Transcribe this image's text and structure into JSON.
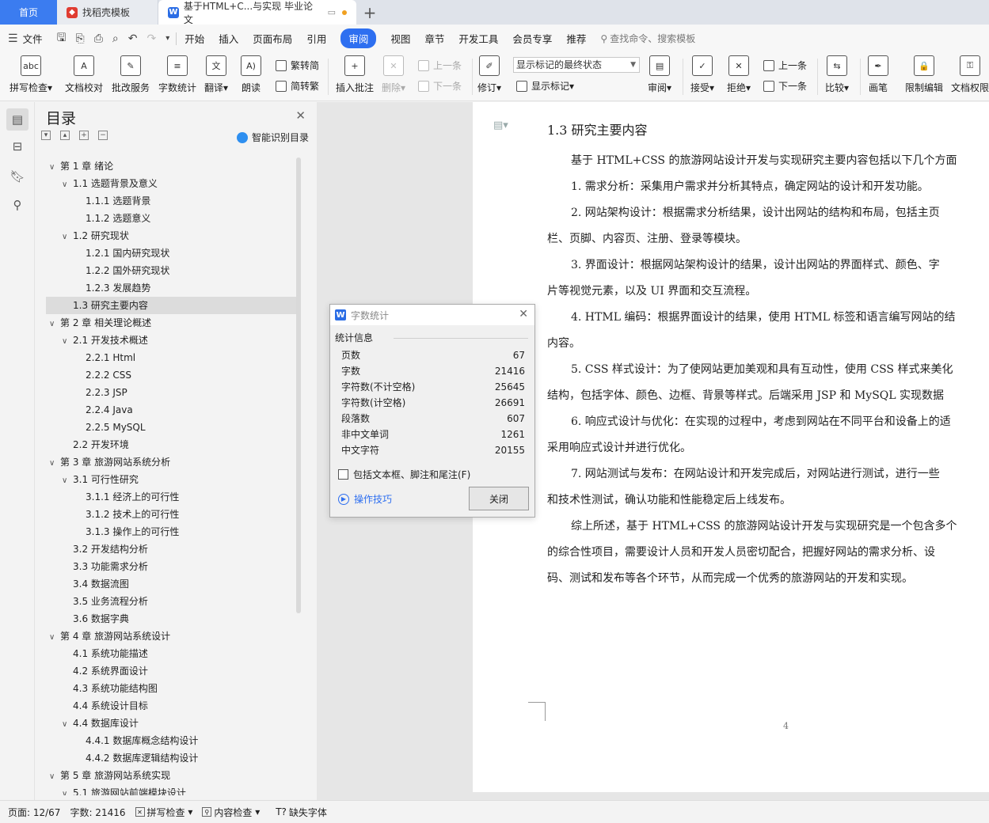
{
  "tabs": {
    "home": "首页",
    "template": "找稻壳模板",
    "document": "基于HTML+C...与实现 毕业论文",
    "new_tab": "+"
  },
  "menu": {
    "file": "文件",
    "items": [
      "开始",
      "插入",
      "页面布局",
      "引用",
      "审阅",
      "视图",
      "章节",
      "开发工具",
      "会员专享",
      "推荐"
    ],
    "active": "审阅",
    "search": "查找命令、搜索模板"
  },
  "ribbon": {
    "spell_check": "拼写检查",
    "doc_proof": "文档校对",
    "batch_service": "批改服务",
    "word_count": "字数统计",
    "translate": "翻译",
    "read_aloud": "朗读",
    "trad_simp": "繁转简",
    "simp_trad": "简转繁",
    "insert_comment": "插入批注",
    "delete": "删除",
    "prev_comment": "上一条",
    "next_comment": "下一条",
    "revise": "修订",
    "markup_state": "显示标记的最终状态",
    "show_markup": "显示标记",
    "review": "审阅",
    "accept": "接受",
    "reject": "拒绝",
    "prev_change": "上一条",
    "next_change": "下一条",
    "compare": "比较",
    "brush": "画笔",
    "restrict_edit": "限制编辑",
    "doc_permission": "文档权限"
  },
  "toc": {
    "title": "目录",
    "smart": "智能识别目录",
    "selected_index": 8,
    "items": [
      {
        "level": 0,
        "caret": "down",
        "label": "第 1 章  绪论"
      },
      {
        "level": 1,
        "caret": "down",
        "label": "1.1  选题背景及意义"
      },
      {
        "level": 2,
        "caret": "",
        "label": "1.1.1 选题背景"
      },
      {
        "level": 2,
        "caret": "",
        "label": "1.1.2 选题意义"
      },
      {
        "level": 1,
        "caret": "down",
        "label": "1.2  研究现状"
      },
      {
        "level": 2,
        "caret": "",
        "label": "1.2.1 国内研究现状"
      },
      {
        "level": 2,
        "caret": "",
        "label": "1.2.2 国外研究现状"
      },
      {
        "level": 2,
        "caret": "",
        "label": "1.2.3 发展趋势"
      },
      {
        "level": 1,
        "caret": "",
        "label": "1.3  研究主要内容"
      },
      {
        "level": 0,
        "caret": "down",
        "label": "第 2 章  相关理论概述"
      },
      {
        "level": 1,
        "caret": "down",
        "label": "2.1 开发技术概述"
      },
      {
        "level": 2,
        "caret": "",
        "label": "2.2.1 Html"
      },
      {
        "level": 2,
        "caret": "",
        "label": "2.2.2 CSS"
      },
      {
        "level": 2,
        "caret": "",
        "label": "2.2.3 JSP"
      },
      {
        "level": 2,
        "caret": "",
        "label": "2.2.4 Java"
      },
      {
        "level": 2,
        "caret": "",
        "label": "2.2.5 MySQL"
      },
      {
        "level": 1,
        "caret": "",
        "label": "2.2  开发环境"
      },
      {
        "level": 0,
        "caret": "down",
        "label": "第 3 章  旅游网站系统分析"
      },
      {
        "level": 1,
        "caret": "down",
        "label": "3.1 可行性研究"
      },
      {
        "level": 2,
        "caret": "",
        "label": "3.1.1 经济上的可行性"
      },
      {
        "level": 2,
        "caret": "",
        "label": "3.1.2 技术上的可行性"
      },
      {
        "level": 2,
        "caret": "",
        "label": "3.1.3 操作上的可行性"
      },
      {
        "level": 1,
        "caret": "",
        "label": "3.2 开发结构分析"
      },
      {
        "level": 1,
        "caret": "",
        "label": "3.3 功能需求分析"
      },
      {
        "level": 1,
        "caret": "",
        "label": "3.4  数据流图"
      },
      {
        "level": 1,
        "caret": "",
        "label": "3.5  业务流程分析"
      },
      {
        "level": 1,
        "caret": "",
        "label": "3.6  数据字典"
      },
      {
        "level": 0,
        "caret": "down",
        "label": "第 4 章  旅游网站系统设计"
      },
      {
        "level": 1,
        "caret": "",
        "label": "4.1 系统功能描述"
      },
      {
        "level": 1,
        "caret": "",
        "label": "4.2 系统界面设计"
      },
      {
        "level": 1,
        "caret": "",
        "label": "4.3 系统功能结构图"
      },
      {
        "level": 1,
        "caret": "",
        "label": "4.4 系统设计目标"
      },
      {
        "level": 1,
        "caret": "down",
        "label": "4.4 数据库设计"
      },
      {
        "level": 2,
        "caret": "",
        "label": "4.4.1 数据库概念结构设计"
      },
      {
        "level": 2,
        "caret": "",
        "label": "4.4.2 数据库逻辑结构设计"
      },
      {
        "level": 0,
        "caret": "down",
        "label": "第 5 章  旅游网站系统实现"
      },
      {
        "level": 1,
        "caret": "down",
        "label": "5.1 旅游网站前端模块设计"
      }
    ]
  },
  "document": {
    "heading": "1.3  研究主要内容",
    "lines": [
      {
        "indent": true,
        "text": "基于 HTML+CSS 的旅游网站设计开发与实现研究主要内容包括以下几个方面"
      },
      {
        "indent": true,
        "text": "1. 需求分析：采集用户需求并分析其特点，确定网站的设计和开发功能。"
      },
      {
        "indent": true,
        "text": "2. 网站架构设计：根据需求分析结果，设计出网站的结构和布局，包括主页"
      },
      {
        "indent": false,
        "text": "栏、页脚、内容页、注册、登录等模块。"
      },
      {
        "indent": true,
        "text": "3. 界面设计：根据网站架构设计的结果，设计出网站的界面样式、颜色、字"
      },
      {
        "indent": false,
        "text": "片等视觉元素，以及 UI 界面和交互流程。"
      },
      {
        "indent": true,
        "text": "4. HTML 编码：根据界面设计的结果，使用 HTML 标签和语言编写网站的结"
      },
      {
        "indent": false,
        "text": "内容。"
      },
      {
        "indent": true,
        "text": "5. CSS 样式设计：为了使网站更加美观和具有互动性，使用 CSS 样式来美化"
      },
      {
        "indent": false,
        "text": "结构，包括字体、颜色、边框、背景等样式。后端采用 JSP 和 MySQL 实现数据"
      },
      {
        "indent": true,
        "text": "6. 响应式设计与优化：在实现的过程中，考虑到网站在不同平台和设备上的适"
      },
      {
        "indent": false,
        "text": "采用响应式设计并进行优化。"
      },
      {
        "indent": true,
        "text": "7. 网站测试与发布：在网站设计和开发完成后，对网站进行测试，进行一些"
      },
      {
        "indent": false,
        "text": "和技术性测试，确认功能和性能稳定后上线发布。"
      },
      {
        "indent": true,
        "text": "综上所述，基于 HTML+CSS 的旅游网站设计开发与实现研究是一个包含多个"
      },
      {
        "indent": false,
        "text": "的综合性项目，需要设计人员和开发人员密切配合，把握好网站的需求分析、设"
      },
      {
        "indent": false,
        "text": "码、测试和发布等各个环节，从而完成一个优秀的旅游网站的开发和实现。"
      }
    ],
    "page_number": "4"
  },
  "dialog": {
    "title": "字数统计",
    "section": "统计信息",
    "rows": [
      {
        "label": "页数",
        "value": "67"
      },
      {
        "label": "字数",
        "value": "21416"
      },
      {
        "label": "字符数(不计空格)",
        "value": "25645"
      },
      {
        "label": "字符数(计空格)",
        "value": "26691"
      },
      {
        "label": "段落数",
        "value": "607"
      },
      {
        "label": "非中文单词",
        "value": "1261"
      },
      {
        "label": "中文字符",
        "value": "20155"
      }
    ],
    "include_label": "包括文本框、脚注和尾注(F)",
    "tips": "操作技巧",
    "close": "关闭"
  },
  "status": {
    "page": "页面: 12/67",
    "words": "字数: 21416",
    "spell": "拼写检查",
    "content": "内容检查",
    "missing_font": "缺失字体"
  },
  "colors": {
    "accent": "#2e6ff0",
    "home_tab": "#3b7cf0",
    "unsaved_dot": "#f0a020"
  }
}
